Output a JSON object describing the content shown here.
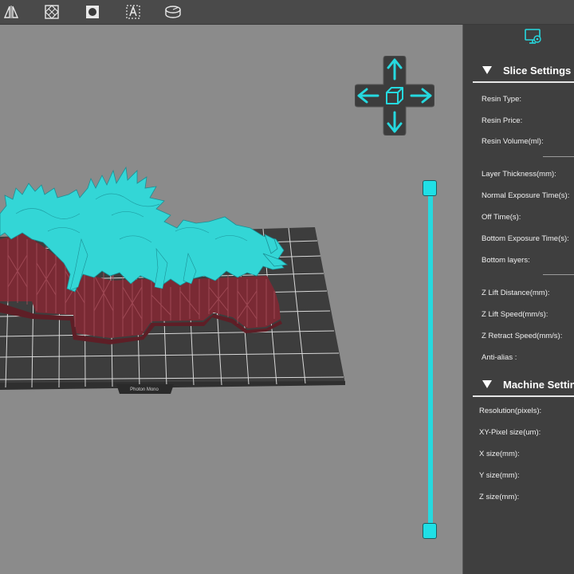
{
  "toolbar": {
    "icons": [
      "mirror-icon",
      "hollow-icon",
      "punch-hole-icon",
      "text-icon",
      "slice-volume-icon"
    ]
  },
  "viewport": {
    "build_plate_label": "Photon Mono",
    "view_control": "view-cube-dpad"
  },
  "panel": {
    "header_icon": "monitor-settings-icon",
    "slice_settings": {
      "title": "Slice Settings",
      "fields": [
        {
          "label": "Resin Type:"
        },
        {
          "label": "Resin Price:"
        },
        {
          "label": "Resin Volume(ml):"
        },
        {
          "label": "Layer Thickness(mm):"
        },
        {
          "label": "Normal Exposure Time(s):"
        },
        {
          "label": "Off Time(s):"
        },
        {
          "label": "Bottom Exposure Time(s):"
        },
        {
          "label": "Bottom layers:"
        },
        {
          "label": "Z Lift Distance(mm):"
        },
        {
          "label": "Z Lift Speed(mm/s):"
        },
        {
          "label": "Z Retract Speed(mm/s):"
        },
        {
          "label": "Anti-alias :"
        }
      ]
    },
    "machine_settings": {
      "title": "Machine Settin",
      "fields": [
        {
          "label": "Resolution(pixels):"
        },
        {
          "label": "XY-Pixel size(um):"
        },
        {
          "label": "X size(mm):"
        },
        {
          "label": "Y size(mm):"
        },
        {
          "label": "Z size(mm):"
        }
      ]
    }
  },
  "colors": {
    "accent": "#26d9df",
    "model": "#33d6d6",
    "supports": "#7a2a34",
    "panel_bg": "#3f3f3f",
    "viewport_bg": "#8b8b8b"
  }
}
